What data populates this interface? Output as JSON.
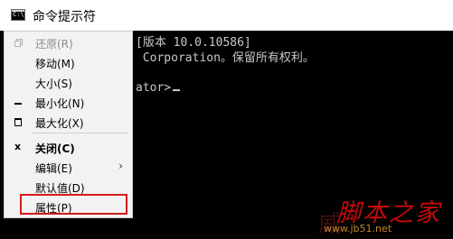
{
  "window": {
    "title": "命令提示符",
    "icon": "cmd-icon",
    "icon_glyph": "C:\\"
  },
  "console": {
    "lines": [
      "[版本 10.0.10586]",
      " Corporation。保留所有权利。",
      "ator>"
    ]
  },
  "system_menu": {
    "items": [
      {
        "label": "还原(R)",
        "enabled": false,
        "icon": "restore-icon"
      },
      {
        "label": "移动(M)",
        "enabled": true
      },
      {
        "label": "大小(S)",
        "enabled": true
      },
      {
        "label": "最小化(N)",
        "enabled": true,
        "icon": "minimize-icon"
      },
      {
        "label": "最大化(X)",
        "enabled": true,
        "icon": "maximize-icon"
      },
      {
        "label": "关闭(C)",
        "enabled": true,
        "bold": true,
        "icon": "close-icon",
        "icon_glyph": "x"
      },
      {
        "label": "编辑(E)",
        "enabled": true,
        "submenu": true,
        "submenu_glyph": "›"
      },
      {
        "label": "默认值(D)",
        "enabled": true
      },
      {
        "label": "属性(P)",
        "enabled": true,
        "highlighted": true
      }
    ],
    "highlight_color": "#d61a1a"
  },
  "watermark": {
    "text": "脚本之家",
    "faded_text": "威",
    "url": "www.jb51.net",
    "color": "#c40a0a"
  }
}
